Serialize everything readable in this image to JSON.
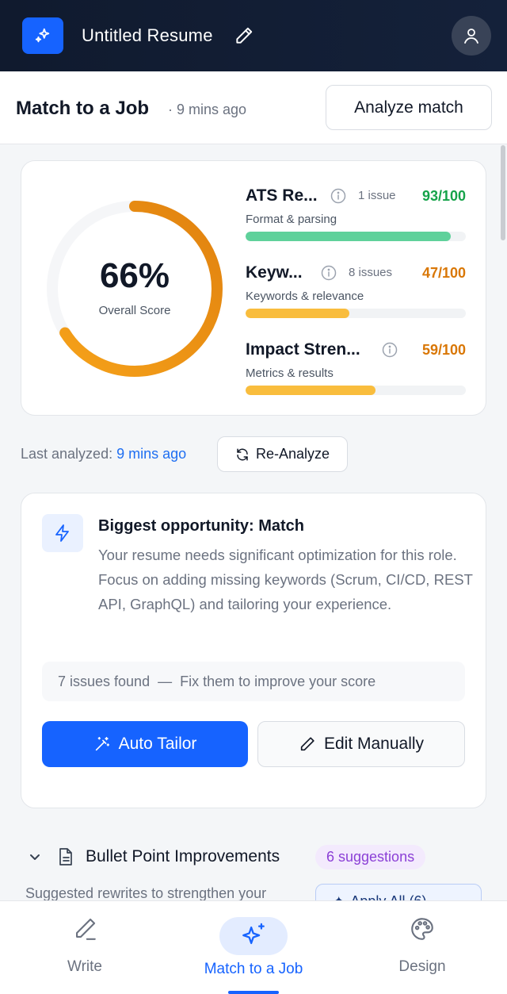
{
  "header": {
    "doc_title": "Untitled Resume"
  },
  "subheader": {
    "title": "Match to a Job",
    "time": "· 9 mins ago",
    "analyze_label": "Analyze match"
  },
  "score": {
    "percent_text": "66%",
    "percent_value": 66,
    "label": "Overall Score",
    "metrics": [
      {
        "name": "ATS Re...",
        "issues": "1 issue",
        "score": "93/100",
        "value": 93,
        "sub": "Format & parsing",
        "color": "#5fd19b",
        "score_color": "#16a34a"
      },
      {
        "name": "Keyw...",
        "issues": "8 issues",
        "score": "47/100",
        "value": 47,
        "sub": "Keywords & relevance",
        "color": "#f9bd3d",
        "score_color": "#d97706"
      },
      {
        "name": "Impact Stren...",
        "issues": "",
        "score": "59/100",
        "value": 59,
        "sub": "Metrics & results",
        "color": "#f9bd3d",
        "score_color": "#d97706"
      }
    ]
  },
  "last_analyzed": {
    "label": "Last analyzed:",
    "time": "9 mins ago",
    "reanalyze_label": "Re-Analyze"
  },
  "opportunity": {
    "title": "Biggest opportunity: Match",
    "body": "Your resume needs significant optimization for this role. Focus on adding missing keywords (Scrum, CI/CD, REST API, GraphQL) and tailoring your experience.",
    "issues_strip": "7 issues found  —  Fix them to improve your score",
    "auto_label": "Auto Tailor",
    "manual_label": "Edit Manually"
  },
  "bullets": {
    "title": "Bullet Point Improvements",
    "badge": "6 suggestions",
    "subtitle": "Suggested rewrites to strengthen your",
    "apply_label": "Apply All (6)"
  },
  "nav": {
    "items": [
      {
        "label": "Write"
      },
      {
        "label": "Match to a Job"
      },
      {
        "label": "Design"
      }
    ]
  },
  "colors": {
    "brand": "#1663ff",
    "gauge": "#f0961c",
    "header_bg": "#101a2e"
  }
}
